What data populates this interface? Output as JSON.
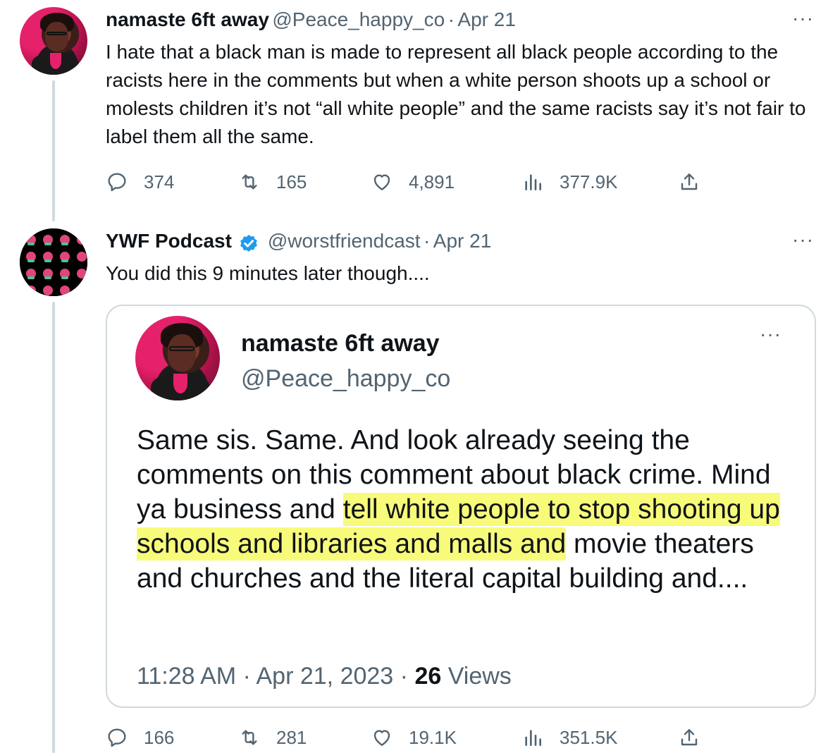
{
  "tweet1": {
    "name": "namaste 6ft away",
    "handle": "@Peace_happy_co",
    "dot": "·",
    "date": "Apr 21",
    "more": "···",
    "text": "I hate that a black man is made to represent all black people according to the racists here in the comments but when a white person shoots up a school or molests children it’s not “all white people” and the same racists say it’s not fair to label them all the same.",
    "replies": "374",
    "retweets": "165",
    "likes": "4,891",
    "views": "377.9K"
  },
  "tweet2": {
    "name": "YWF Podcast",
    "handle": "@worstfriendcast",
    "dot": "·",
    "date": "Apr 21",
    "more": "···",
    "text": "You did this 9 minutes later though....",
    "replies": "166",
    "retweets": "281",
    "likes": "19.1K",
    "views": "351.5K"
  },
  "quoted": {
    "name": "namaste 6ft away",
    "handle": "@Peace_happy_co",
    "more": "···",
    "text_before": "Same sis. Same. And look already seeing the comments on this comment about black crime. Mind ya business and ",
    "text_highlight": "tell white people to stop shooting up schools and libraries and malls and",
    "text_after": " movie theaters and churches and the literal capital building and....",
    "time": "11:28 AM",
    "dot": "·",
    "date": "Apr 21, 2023",
    "views_count": "26",
    "views_label": "Views"
  },
  "colors": {
    "text": "#0f1419",
    "secondary": "#536471",
    "border": "#cfd9de",
    "verified": "#1d9bf0",
    "highlight": "#f5fa46"
  },
  "icons": [
    "reply-icon",
    "retweet-icon",
    "like-icon",
    "views-icon",
    "share-icon",
    "verified-badge-icon",
    "more-icon"
  ]
}
